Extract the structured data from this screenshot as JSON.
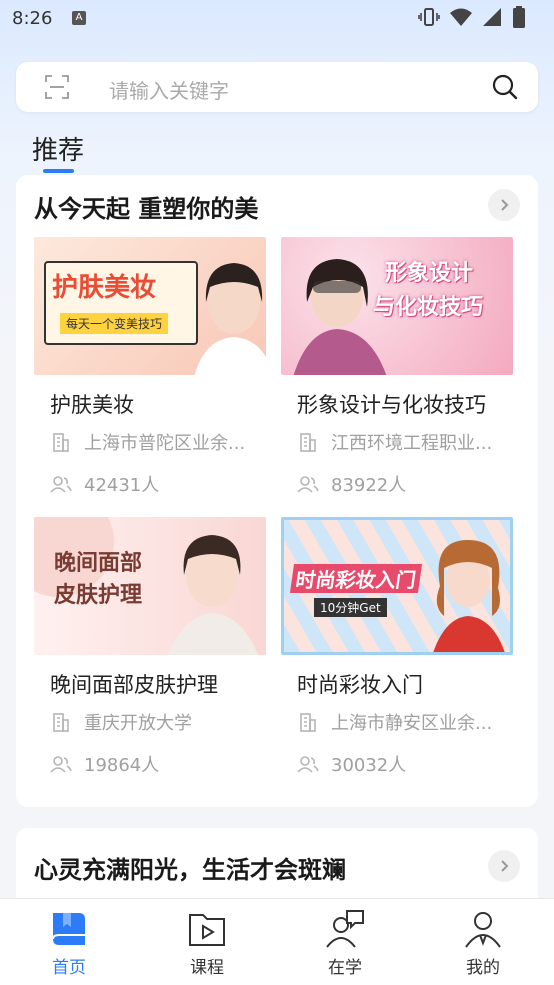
{
  "status_bar": {
    "time": "8:26",
    "a_badge": "A"
  },
  "search": {
    "placeholder": "请输入关键字",
    "scan_icon": "scan-icon",
    "search_icon": "search-icon"
  },
  "section_tab": {
    "label": "推荐"
  },
  "sections": [
    {
      "title": "从今天起 重塑你的美",
      "courses": [
        {
          "name": "护肤美妆",
          "school": "上海市普陀区业余...",
          "count": "42431人",
          "thumb_title": "护肤美妆",
          "thumb_sub": "每天一个变美技巧",
          "thumb_colors": [
            "#fde0d0",
            "#f6b8a4"
          ]
        },
        {
          "name": "形象设计与化妆技巧",
          "school": "江西环境工程职业...",
          "count": "83922人",
          "thumb_title": "形象设计",
          "thumb_title2": "与化妆技巧",
          "thumb_colors": [
            "#f9d0dc",
            "#f3a7bd"
          ]
        },
        {
          "name": "晚间面部皮肤护理",
          "school": "重庆开放大学",
          "count": "19864人",
          "thumb_title": "晚间面部",
          "thumb_title2": "皮肤护理",
          "thumb_colors": [
            "#fbe6e6",
            "#f4c9c7"
          ]
        },
        {
          "name": "时尚彩妆入门",
          "school": "上海市静安区业余...",
          "count": "30032人",
          "thumb_title": "时尚彩妆入门",
          "thumb_sub": "10分钟Get",
          "thumb_colors": [
            "#d7ebf8",
            "#f7d6d2"
          ]
        }
      ]
    },
    {
      "title": "心灵充满阳光，生活才会斑斓"
    }
  ],
  "bottom_nav": [
    {
      "label": "首页",
      "icon": "book-icon",
      "active": true
    },
    {
      "label": "课程",
      "icon": "video-folder-icon",
      "active": false
    },
    {
      "label": "在学",
      "icon": "user-chat-icon",
      "active": false
    },
    {
      "label": "我的",
      "icon": "user-profile-icon",
      "active": false
    }
  ],
  "colors": {
    "accent": "#2b7cf6",
    "meta": "#a0a0a0"
  }
}
